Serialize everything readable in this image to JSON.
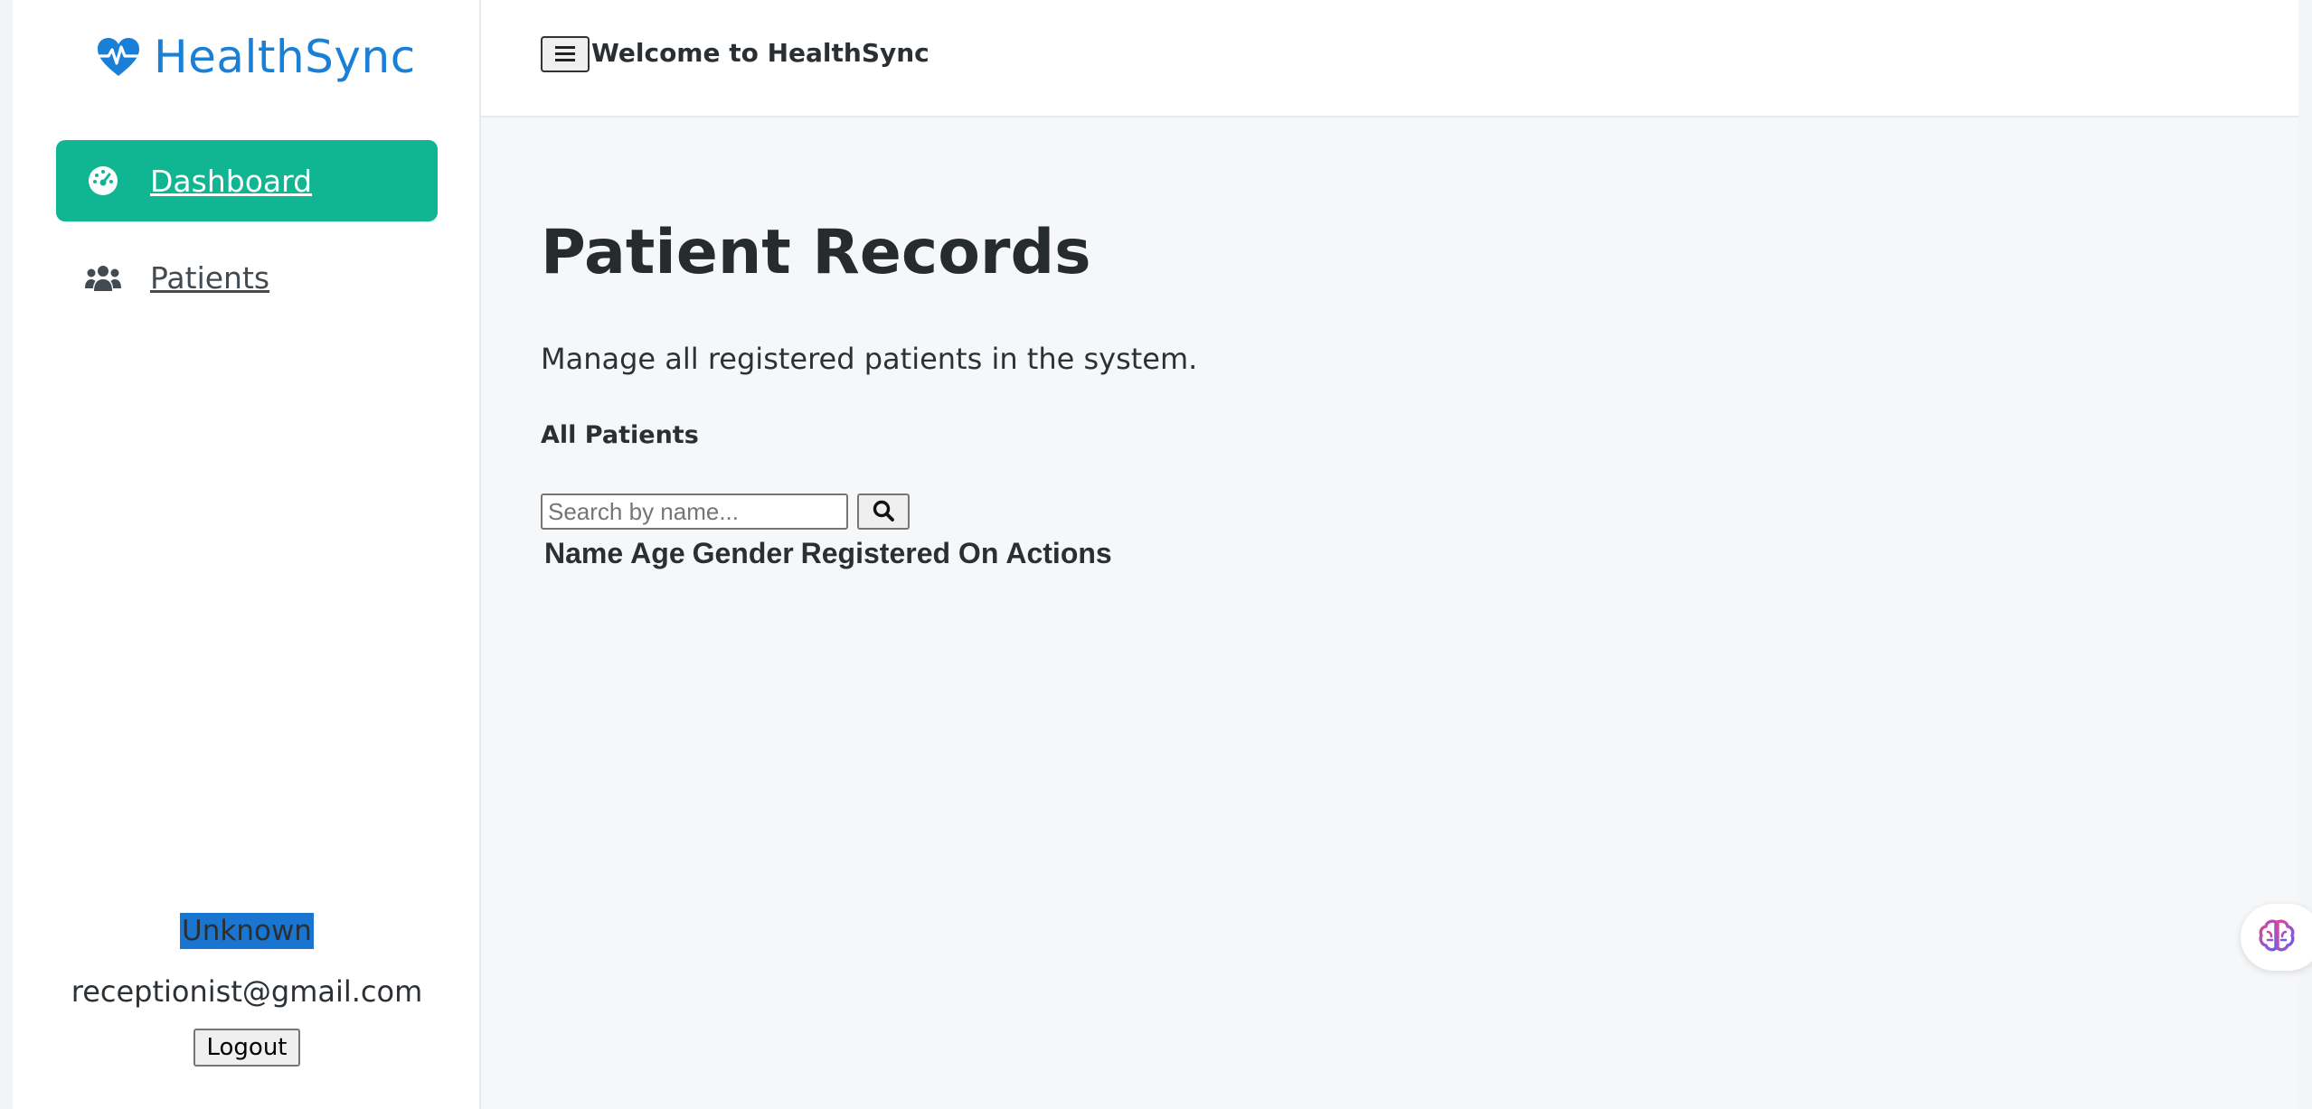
{
  "brand": {
    "name": "HealthSync"
  },
  "sidebar": {
    "items": [
      {
        "label": "Dashboard",
        "icon": "dashboard-icon",
        "active": true
      },
      {
        "label": "Patients",
        "icon": "users-icon",
        "active": false
      }
    ]
  },
  "user": {
    "name": "Unknown",
    "email": "receptionist@gmail.com",
    "logout_label": "Logout"
  },
  "topbar": {
    "welcome": "Welcome to HealthSync",
    "menu_icon": "hamburger-icon"
  },
  "main": {
    "title": "Patient Records",
    "subtitle": "Manage all registered patients in the system.",
    "section_title": "All Patients",
    "search": {
      "placeholder": "Search by name...",
      "value": "",
      "icon": "search-icon"
    },
    "table": {
      "columns": [
        "Name",
        "Age",
        "Gender",
        "Registered On",
        "Actions"
      ],
      "rows": []
    }
  },
  "floating": {
    "icon": "brain-icon"
  },
  "colors": {
    "brand": "#1a7fd6",
    "active_nav": "#10b591",
    "user_highlight": "#1a75d0"
  }
}
